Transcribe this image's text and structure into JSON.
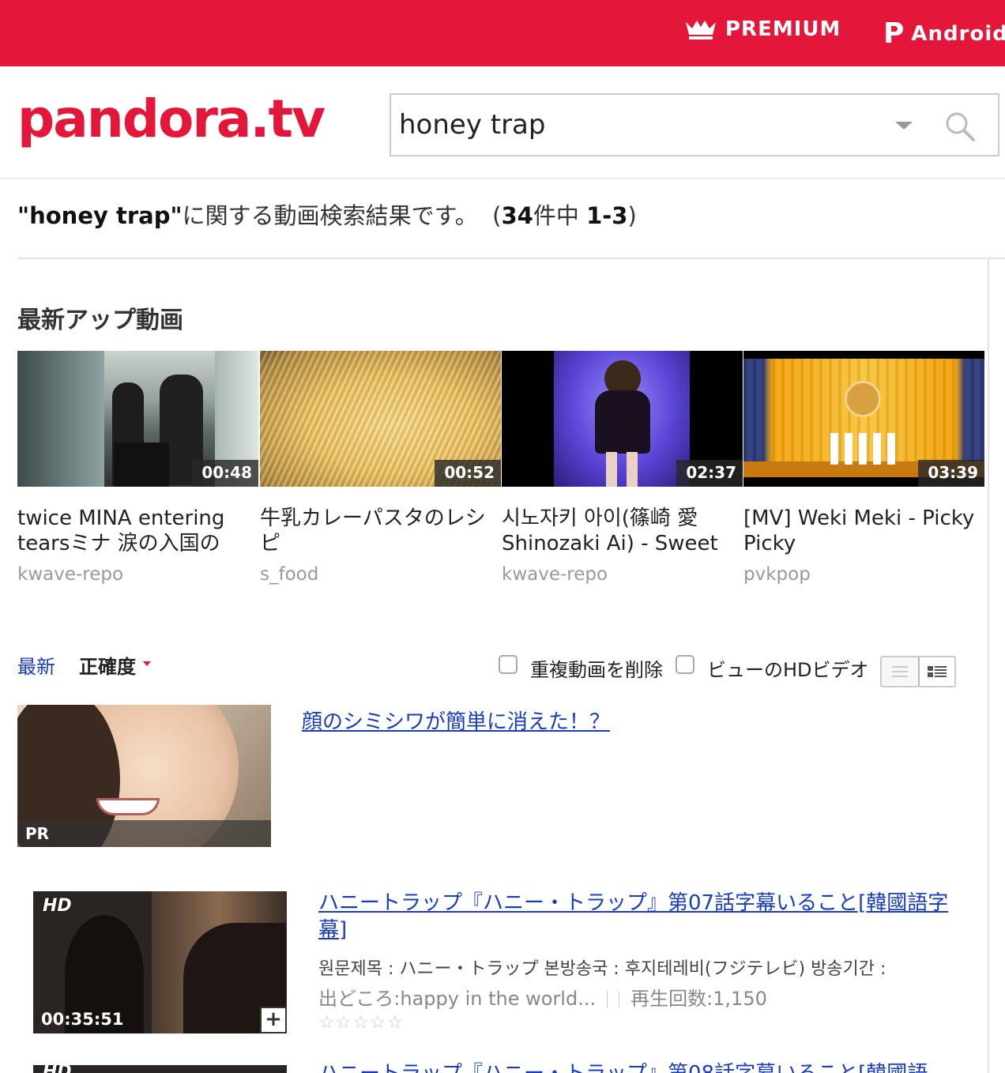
{
  "topbar": {
    "premium_label": "PREMIUM",
    "android_label": "Android L",
    "color": "#e4173b"
  },
  "header": {
    "logo": "pandora.tv"
  },
  "search": {
    "value": "honey trap"
  },
  "summary": {
    "query": "\"honey trap\"",
    "text": "に関する動画検索結果です。",
    "count_open": "(",
    "count": "34",
    "count_unit": "件中",
    "range": "1-3",
    "count_close": ")"
  },
  "latest": {
    "title": "最新アップ動画",
    "cards": [
      {
        "duration": "00:48",
        "title": "twice MINA entering tearsミナ 涙の入国の",
        "user": "kwave-repo"
      },
      {
        "duration": "00:52",
        "title": "牛乳カレーパスタのレシピ",
        "user": "s_food"
      },
      {
        "duration": "02:37",
        "title": "시노자키 아이(篠崎 愛 Shinozaki Ai) - Sweet",
        "user": "kwave-repo"
      },
      {
        "duration": "03:39",
        "title": "[MV] Weki Meki - Picky Picky",
        "user": "pvkpop"
      }
    ]
  },
  "sort": {
    "latest": "最新",
    "accuracy": "正確度"
  },
  "filters": {
    "remove_duplicates": "重複動画を削除",
    "hd_only": "ビューのHDビデオ"
  },
  "pr": {
    "badge": "PR",
    "link": "顔のシミシワが簡単に消えた！？"
  },
  "results": [
    {
      "badge": "HD",
      "duration": "00:35:51",
      "plus": "+",
      "title": "ハニートラップ『ハニー・トラップ』第07話字幕いること[韓國語字幕]",
      "desc": "원문제목 : ハニー・トラップ 본방송국 : 후지테레비(フジテレビ) 방송기간 :",
      "source": "出どころ:happy in the world...",
      "plays": "再生回数:1,150",
      "stars": [
        "☆",
        "☆",
        "☆",
        "☆",
        "☆"
      ]
    },
    {
      "badge": "HD",
      "title": "ハニートラップ『ハニー・トラップ』第08話字幕いること[韓國語"
    }
  ]
}
